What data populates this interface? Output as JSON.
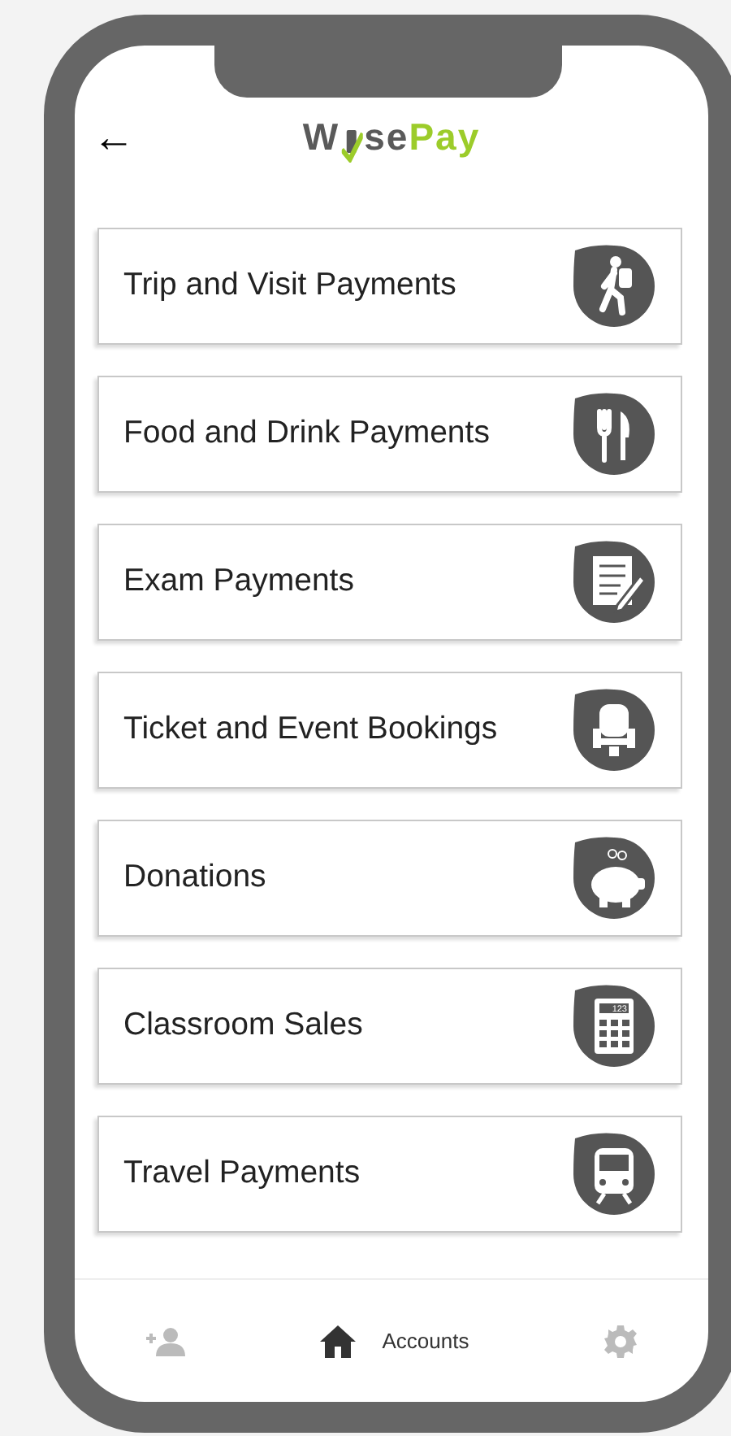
{
  "header": {
    "back": "←",
    "logo": {
      "before": "W",
      "after": "se",
      "accent": "Pay"
    }
  },
  "items": [
    {
      "label": "Trip and Visit Payments",
      "kind": "hiker"
    },
    {
      "label": "Food and Drink Payments",
      "kind": "cutlery"
    },
    {
      "label": "Exam Payments",
      "kind": "exam"
    },
    {
      "label": "Ticket and Event Bookings",
      "kind": "seat"
    },
    {
      "label": "Donations",
      "kind": "piggy"
    },
    {
      "label": "Classroom Sales",
      "kind": "calculator",
      "display": "123"
    },
    {
      "label": "Travel Payments",
      "kind": "train"
    }
  ],
  "nav": [
    {
      "kind": "add-user",
      "selected": false
    },
    {
      "kind": "home",
      "label": "Accounts",
      "selected": true
    },
    {
      "kind": "settings",
      "selected": false
    }
  ]
}
